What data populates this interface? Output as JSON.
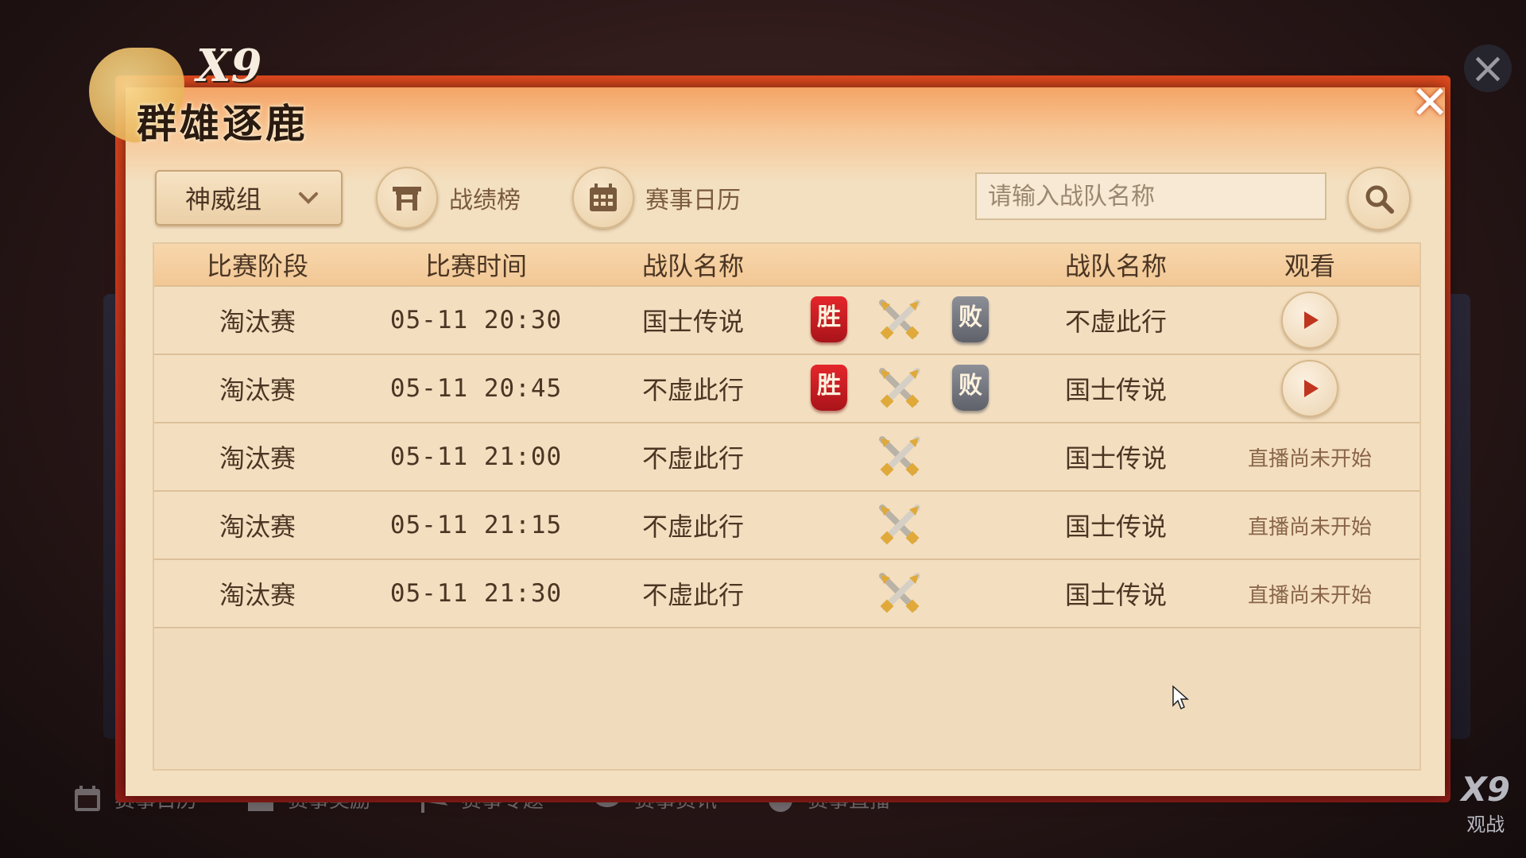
{
  "header": {
    "logo_mark": "X9",
    "logo_title": "群雄逐鹿",
    "close_glyph": "✕"
  },
  "toolbar": {
    "group_select": {
      "value": "神威组",
      "icon": "chevron-down-icon"
    },
    "ranking_label": "战绩榜",
    "ranking_icon": "gate-icon",
    "calendar_label": "赛事日历",
    "calendar_icon": "calendar-icon",
    "search": {
      "placeholder": "请输入战队名称",
      "value": "",
      "icon": "search-icon"
    }
  },
  "table": {
    "headers": {
      "stage": "比赛阶段",
      "time": "比赛时间",
      "team1": "战队名称",
      "team2": "战队名称",
      "watch": "观看"
    },
    "win_label": "胜",
    "lose_label": "败",
    "rows": [
      {
        "stage": "淘汰赛",
        "time": "05-11 20:30",
        "team1": "国士传说",
        "team2": "不虚此行",
        "result": "team1_win",
        "watch": "play"
      },
      {
        "stage": "淘汰赛",
        "time": "05-11 20:45",
        "team1": "不虚此行",
        "team2": "国士传说",
        "result": "team1_win",
        "watch": "play"
      },
      {
        "stage": "淘汰赛",
        "time": "05-11 21:00",
        "team1": "不虚此行",
        "team2": "国士传说",
        "result": "none",
        "watch": "直播尚未开始"
      },
      {
        "stage": "淘汰赛",
        "time": "05-11 21:15",
        "team1": "不虚此行",
        "team2": "国士传说",
        "result": "none",
        "watch": "直播尚未开始"
      },
      {
        "stage": "淘汰赛",
        "time": "05-11 21:30",
        "team1": "不虚此行",
        "team2": "国士传说",
        "result": "none",
        "watch": "直播尚未开始"
      }
    ]
  },
  "bottom_nav": {
    "items": [
      {
        "label": "赛事日历",
        "icon": "calendar-icon"
      },
      {
        "label": "赛事奖励",
        "icon": "gift-icon"
      },
      {
        "label": "赛事专题",
        "icon": "flag-icon"
      },
      {
        "label": "赛事资讯",
        "icon": "chat-icon"
      },
      {
        "label": "赛事直播",
        "icon": "live-icon"
      }
    ],
    "logo": "X9",
    "logo_sub": "观战"
  },
  "colors": {
    "win": "#d91f25",
    "lose": "#6f717a",
    "frame": "#c52a1a",
    "panel": "#f3e0c0"
  }
}
